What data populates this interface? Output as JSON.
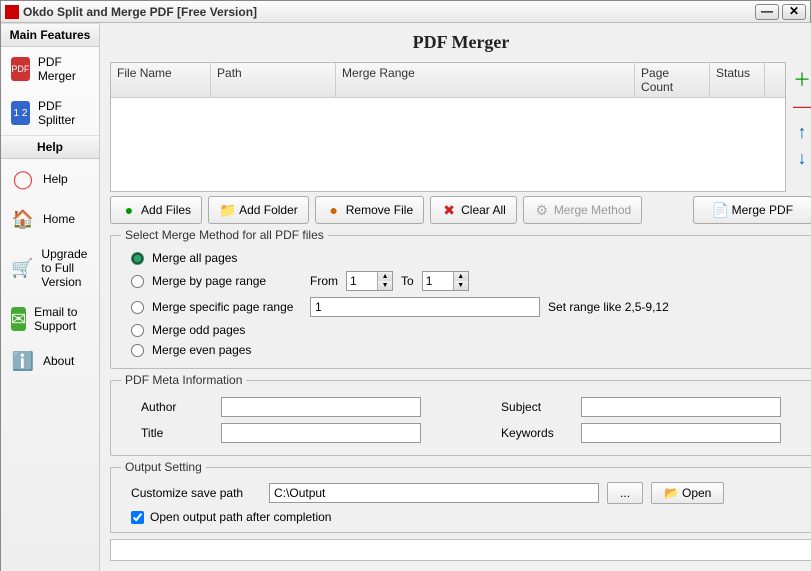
{
  "window": {
    "title": "Okdo Split and Merge PDF [Free Version]"
  },
  "sidebar": {
    "head1": "Main Features",
    "head2": "Help",
    "items": [
      {
        "label": "PDF Merger"
      },
      {
        "label": "PDF Splitter"
      },
      {
        "label": "Help"
      },
      {
        "label": "Home"
      },
      {
        "label": "Upgrade to Full Version"
      },
      {
        "label": "Email to Support"
      },
      {
        "label": "About"
      }
    ]
  },
  "page": {
    "title": "PDF Merger"
  },
  "table": {
    "cols": [
      "File Name",
      "Path",
      "Merge Range",
      "Page Count",
      "Status"
    ]
  },
  "toolbar": {
    "addFiles": "Add Files",
    "addFolder": "Add Folder",
    "removeFile": "Remove File",
    "clearAll": "Clear All",
    "mergeMethod": "Merge Method",
    "mergePDF": "Merge PDF"
  },
  "mergeMethod": {
    "legend": "Select Merge Method for all PDF files",
    "opt1": "Merge all pages",
    "opt2": "Merge by page range",
    "fromLabel": "From",
    "fromVal": "1",
    "toLabel": "To",
    "toVal": "1",
    "opt3": "Merge specific page range",
    "specificVal": "1",
    "hint": "Set range like 2,5-9,12",
    "opt4": "Merge odd pages",
    "opt5": "Merge even pages"
  },
  "meta": {
    "legend": "PDF Meta Information",
    "authorLabel": "Author",
    "titleLabel": "Title",
    "subjectLabel": "Subject",
    "keywordsLabel": "Keywords",
    "author": "",
    "title": "",
    "subject": "",
    "keywords": ""
  },
  "output": {
    "legend": "Output Setting",
    "pathLabel": "Customize save path",
    "pathVal": "C:\\Output",
    "browse": "...",
    "open": "Open",
    "chkLabel": "Open output path after completion"
  }
}
